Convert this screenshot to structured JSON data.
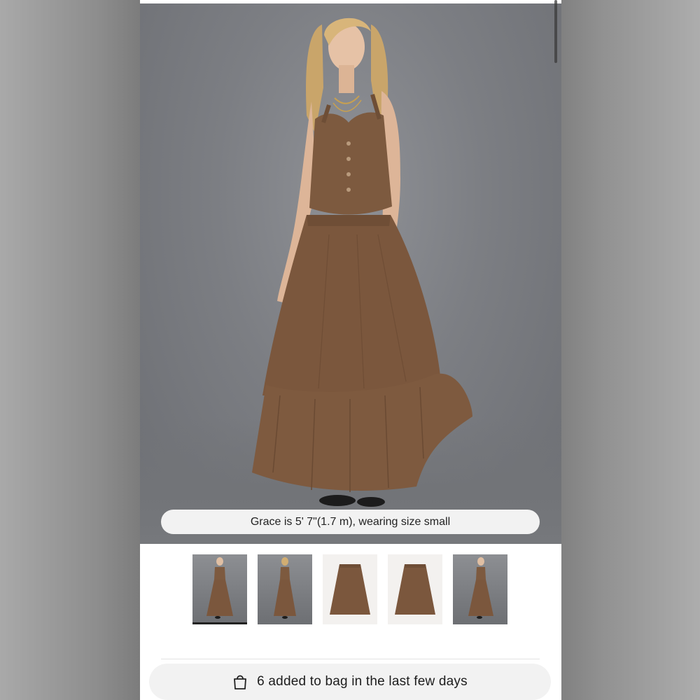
{
  "product_gallery": {
    "caption": "Grace is 5' 7\"(1.7 m), wearing size small",
    "thumbnails": [
      {
        "name": "front-model-view",
        "selected": true
      },
      {
        "name": "back-model-view",
        "selected": false
      },
      {
        "name": "flat-front-view",
        "selected": false
      },
      {
        "name": "flat-back-view",
        "selected": false
      },
      {
        "name": "side-model-view",
        "selected": false
      }
    ]
  },
  "social_proof": {
    "icon": "shopping-bag-icon",
    "text": "6 added to bag in the last few days"
  },
  "colors": {
    "garment": "#7d5a3f",
    "backdrop": "#7c7e83",
    "pill": "#f2f2f2"
  }
}
